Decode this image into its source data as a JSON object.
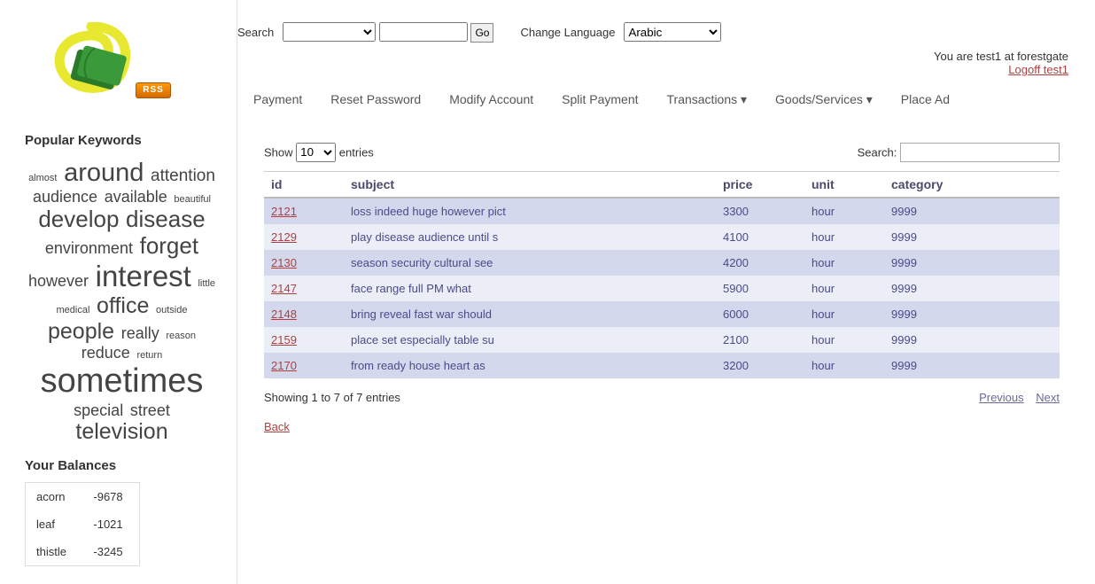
{
  "header": {
    "rss_label": "RSS",
    "search_label": "Search",
    "go_label": "Go",
    "change_lang_label": "Change Language",
    "lang_value": "Arabic",
    "user_text": "You are test1 at forestgate",
    "logoff_text": "Logoff test1"
  },
  "nav": [
    "Payment",
    "Reset Password",
    "Modify Account",
    "Split Payment",
    "Transactions ▾",
    "Goods/Services ▾",
    "Place Ad"
  ],
  "sidebar": {
    "keywords_title": "Popular Keywords",
    "balances_title": "Your Balances",
    "keywords": [
      {
        "text": "almost",
        "size": 11
      },
      {
        "text": "around",
        "size": 29
      },
      {
        "text": "attention",
        "size": 19
      },
      {
        "text": "audience",
        "size": 18
      },
      {
        "text": "available",
        "size": 18
      },
      {
        "text": "beautiful",
        "size": 11
      },
      {
        "text": "develop",
        "size": 26
      },
      {
        "text": "disease",
        "size": 26
      },
      {
        "text": "environment",
        "size": 18
      },
      {
        "text": "forget",
        "size": 26
      },
      {
        "text": "however",
        "size": 18
      },
      {
        "text": "interest",
        "size": 33
      },
      {
        "text": "little",
        "size": 11
      },
      {
        "text": "medical",
        "size": 11
      },
      {
        "text": "office",
        "size": 25
      },
      {
        "text": "outside",
        "size": 11
      },
      {
        "text": "people",
        "size": 25
      },
      {
        "text": "really",
        "size": 18
      },
      {
        "text": "reason",
        "size": 11
      },
      {
        "text": "reduce",
        "size": 18
      },
      {
        "text": "return",
        "size": 11
      },
      {
        "text": "sometimes",
        "size": 38
      },
      {
        "text": "special",
        "size": 18
      },
      {
        "text": "street",
        "size": 18
      },
      {
        "text": "television",
        "size": 25
      }
    ],
    "balances": [
      {
        "name": "acorn",
        "value": "-9678"
      },
      {
        "name": "leaf",
        "value": "-1021"
      },
      {
        "name": "thistle",
        "value": "-3245"
      }
    ]
  },
  "table": {
    "show_label_pre": "Show",
    "show_value": "10",
    "show_label_post": "entries",
    "search_label": "Search:",
    "headers": [
      "id",
      "subject",
      "price",
      "unit",
      "category"
    ],
    "rows": [
      {
        "id": "2121",
        "subject": "loss indeed huge however pict",
        "price": "3300",
        "unit": "hour",
        "category": "9999"
      },
      {
        "id": "2129",
        "subject": "play disease audience until s",
        "price": "4100",
        "unit": "hour",
        "category": "9999"
      },
      {
        "id": "2130",
        "subject": "season security cultural see",
        "price": "4200",
        "unit": "hour",
        "category": "9999"
      },
      {
        "id": "2147",
        "subject": "face range full PM what",
        "price": "5900",
        "unit": "hour",
        "category": "9999"
      },
      {
        "id": "2148",
        "subject": "bring reveal fast war should",
        "price": "6000",
        "unit": "hour",
        "category": "9999"
      },
      {
        "id": "2159",
        "subject": "place set especially table su",
        "price": "2100",
        "unit": "hour",
        "category": "9999"
      },
      {
        "id": "2170",
        "subject": "from ready house heart as",
        "price": "3200",
        "unit": "hour",
        "category": "9999"
      }
    ],
    "info": "Showing 1 to 7 of 7 entries",
    "prev": "Previous",
    "next": "Next",
    "back": "Back"
  }
}
